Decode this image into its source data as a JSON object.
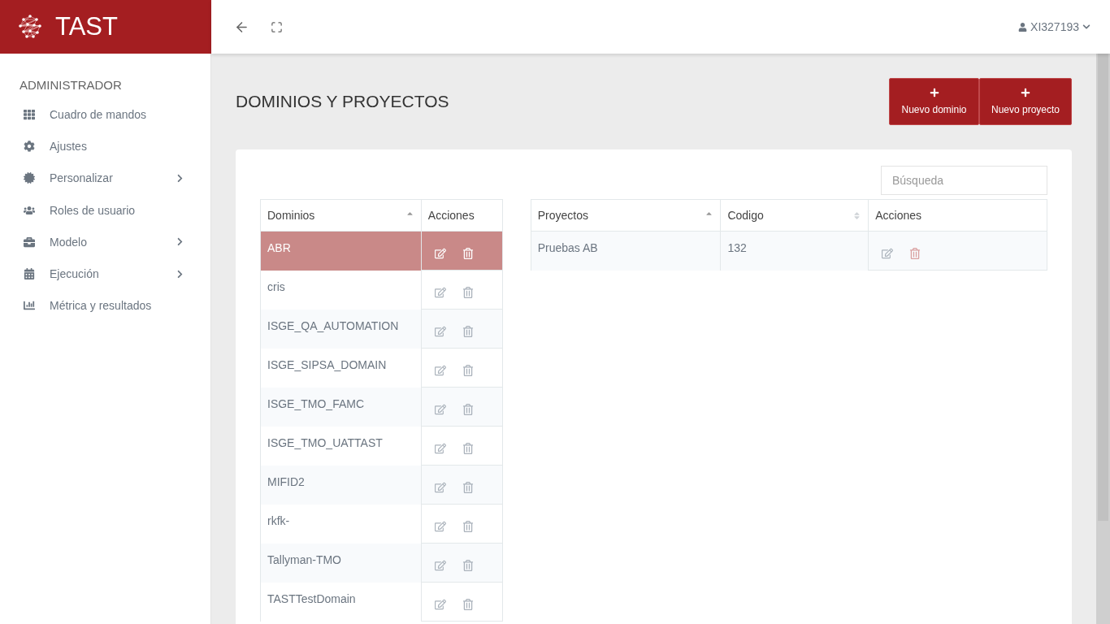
{
  "brand": {
    "name": "TAST"
  },
  "user": {
    "name": "XI327193"
  },
  "sidebar": {
    "heading": "ADMINISTRADOR",
    "items": [
      {
        "label": "Cuadro de mandos",
        "has_submenu": false
      },
      {
        "label": "Ajustes",
        "has_submenu": false
      },
      {
        "label": "Personalizar",
        "has_submenu": true
      },
      {
        "label": "Roles de usuario",
        "has_submenu": false
      },
      {
        "label": "Modelo",
        "has_submenu": true
      },
      {
        "label": "Ejecución",
        "has_submenu": true
      },
      {
        "label": "Métrica y resultados",
        "has_submenu": false
      }
    ]
  },
  "page": {
    "title": "DOMINIOS Y PROYECTOS",
    "buttons": [
      {
        "label": "Nuevo dominio"
      },
      {
        "label": "Nuevo proyecto"
      }
    ]
  },
  "search": {
    "placeholder": "Búsqueda"
  },
  "domains_table": {
    "columns": [
      {
        "label": "Dominios",
        "sortable": true,
        "sorted": true
      },
      {
        "label": "Acciones",
        "sortable": false,
        "sorted": false
      }
    ],
    "rows": [
      {
        "name": "ABR",
        "selected": true
      },
      {
        "name": "cris",
        "selected": false
      },
      {
        "name": "ISGE_QA_AUTOMATION",
        "selected": false
      },
      {
        "name": "ISGE_SIPSA_DOMAIN",
        "selected": false
      },
      {
        "name": "ISGE_TMO_FAMC",
        "selected": false
      },
      {
        "name": "ISGE_TMO_UATTAST",
        "selected": false
      },
      {
        "name": "MIFID2",
        "selected": false
      },
      {
        "name": "rkfk-",
        "selected": false
      },
      {
        "name": "Tallyman-TMO",
        "selected": false
      },
      {
        "name": "TASTTestDomain",
        "selected": false
      }
    ]
  },
  "projects_table": {
    "columns": [
      {
        "label": "Proyectos",
        "sortable": true,
        "sorted": true
      },
      {
        "label": "Codigo",
        "sortable": true,
        "sorted": false
      },
      {
        "label": "Acciones",
        "sortable": false,
        "sorted": false
      }
    ],
    "rows": [
      {
        "name": "Pruebas AB",
        "code": "132",
        "selected": false
      }
    ]
  }
}
